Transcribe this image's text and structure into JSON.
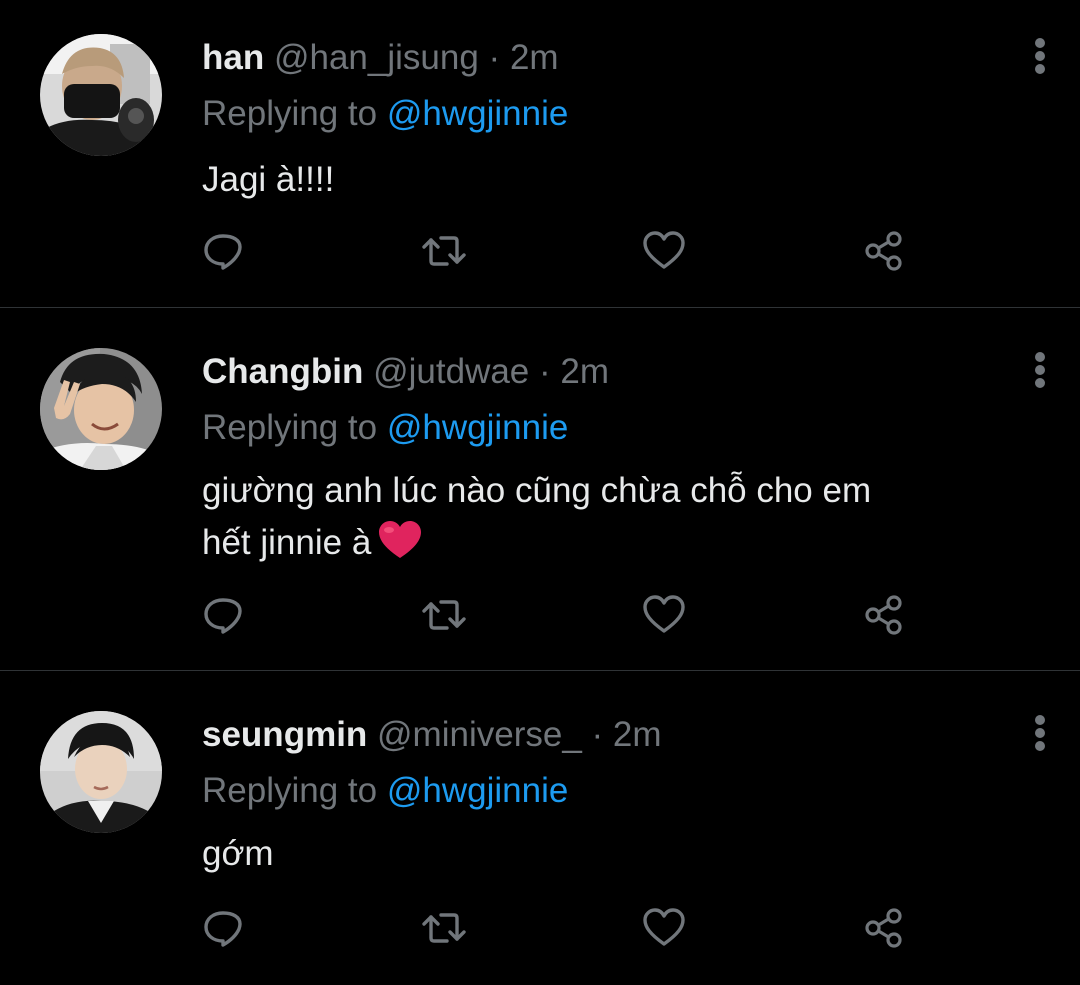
{
  "tweets": [
    {
      "name": "han",
      "handle": "@han_jisung",
      "separator": "·",
      "time": "2m",
      "replying_prefix": "Replying to",
      "replying_to": "@hwgjinnie",
      "text_lines": [
        "Jagi à!!!!"
      ],
      "emoji": ""
    },
    {
      "name": "Changbin",
      "handle": "@jutdwae",
      "separator": "·",
      "time": "2m",
      "replying_prefix": "Replying to",
      "replying_to": "@hwgjinnie",
      "text_lines": [
        "giường anh lúc nào cũng chừa chỗ cho em",
        "hết jinnie à"
      ],
      "emoji": "red-heart"
    },
    {
      "name": "seungmin",
      "handle": "@miniverse_",
      "separator": "·",
      "time": "2m",
      "replying_prefix": "Replying to",
      "replying_to": "@hwgjinnie",
      "text_lines": [
        "gớm"
      ],
      "emoji": ""
    }
  ],
  "actions": {
    "icons": [
      "reply-icon",
      "retweet-icon",
      "like-icon",
      "share-icon"
    ]
  },
  "colors": {
    "background": "#000000",
    "text_primary": "#e7e9ea",
    "text_secondary": "#71767b",
    "accent": "#1d9bf0",
    "divider": "#2f3336",
    "heart_emoji": "#e0245e"
  }
}
